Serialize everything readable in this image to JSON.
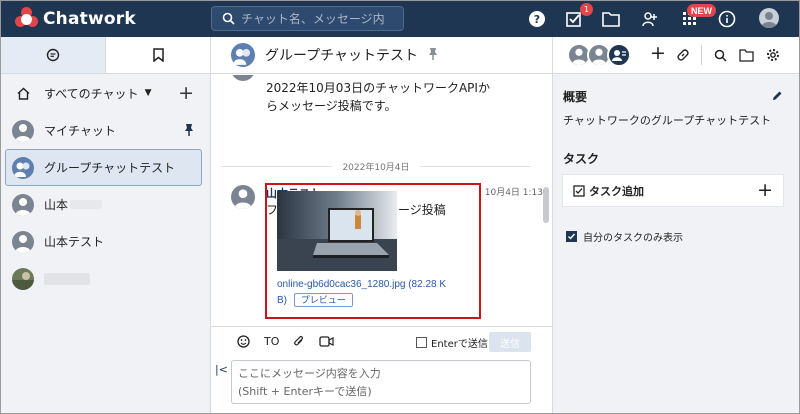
{
  "header": {
    "app_name": "Chatwork",
    "search_placeholder": "チャット名、メッセージ内",
    "task_badge_count": "1",
    "new_badge": "NEW"
  },
  "sidebar": {
    "all_chats_label": "すべてのチャット",
    "rooms": [
      {
        "name": "マイチャット",
        "pinned": true
      },
      {
        "name": "グループチャットテスト",
        "selected": true
      },
      {
        "name": "山本",
        "blurred_suffix": true
      },
      {
        "name": "山本テスト"
      },
      {
        "name": "",
        "blurred": true
      }
    ]
  },
  "chat": {
    "title": "グループチャットテスト",
    "messages": [
      {
        "text_line1": "2022年10月03日のチャットワークAPIか",
        "text_line2": "らメッセージ投稿です。"
      },
      {
        "sender": "山本テスト",
        "time": "10月4日 1:13",
        "text": "ファイル添付したメッセージ投稿",
        "attachment": {
          "filename_line1": "online-gb6d0cac36_1280.jpg (82.28 K",
          "filename_line2": "B)",
          "preview_label": "プレビュー"
        }
      }
    ],
    "date_divider": "2022年10月4日",
    "composer": {
      "to_label": "TO",
      "enter_send_label": "Enterで送信",
      "send_label": "送信",
      "placeholder_line1": "ここにメッセージ内容を入力",
      "placeholder_line2": "(Shift + Enterキーで送信)"
    }
  },
  "right_panel": {
    "summary_title": "概要",
    "summary_text": "チャットワークのグループチャットテスト",
    "task_title": "タスク",
    "add_task_label": "タスク追加",
    "only_mine_label": "自分のタスクのみ表示"
  },
  "colors": {
    "header_bg": "#1f3652",
    "accent_red": "#e2454a",
    "highlight_border": "#d0121a",
    "link_blue": "#2a58a8"
  }
}
